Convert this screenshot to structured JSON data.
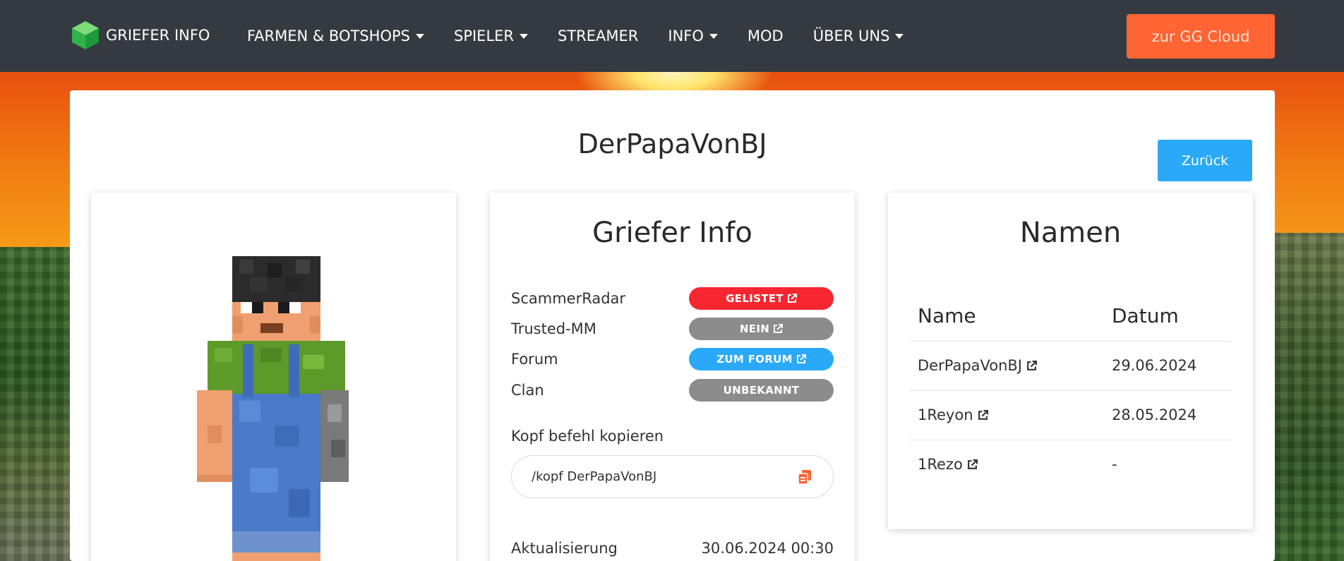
{
  "navbar": {
    "brand": "GRIEFER INFO",
    "items": [
      {
        "label": "FARMEN & BOTSHOPS",
        "dropdown": true
      },
      {
        "label": "SPIELER",
        "dropdown": true
      },
      {
        "label": "STREAMER",
        "dropdown": false
      },
      {
        "label": "INFO",
        "dropdown": true
      },
      {
        "label": "MOD",
        "dropdown": false
      },
      {
        "label": "ÜBER UNS",
        "dropdown": true
      }
    ],
    "cloud_button": "zur GG Cloud"
  },
  "page": {
    "title": "DerPapaVonBJ",
    "back_button": "Zurück"
  },
  "info_card": {
    "title": "Griefer Info",
    "rows": [
      {
        "label": "ScammerRadar",
        "badge": "GELISTET",
        "color": "#f5262f",
        "external": true
      },
      {
        "label": "Trusted-MM",
        "badge": "NEIN",
        "color": "#8c8c8c",
        "external": true
      },
      {
        "label": "Forum",
        "badge": "ZUM FORUM",
        "color": "#2aa9f8",
        "external": true
      },
      {
        "label": "Clan",
        "badge": "UNBEKANNT",
        "color": "#8c8c8c",
        "external": false
      }
    ],
    "copy_label": "Kopf befehl kopieren",
    "copy_command": "/kopf DerPapaVonBJ",
    "update_label": "Aktualisierung",
    "update_value": "30.06.2024 00:30"
  },
  "names_card": {
    "title": "Namen",
    "columns": [
      "Name",
      "Datum"
    ],
    "rows": [
      {
        "name": "DerPapaVonBJ",
        "date": "29.06.2024"
      },
      {
        "name": "1Reyon",
        "date": "28.05.2024"
      },
      {
        "name": "1Rezo",
        "date": "-"
      }
    ]
  },
  "colors": {
    "navbar": "#343a40",
    "accent_orange": "#ff6433",
    "accent_blue": "#2aa9f8"
  }
}
